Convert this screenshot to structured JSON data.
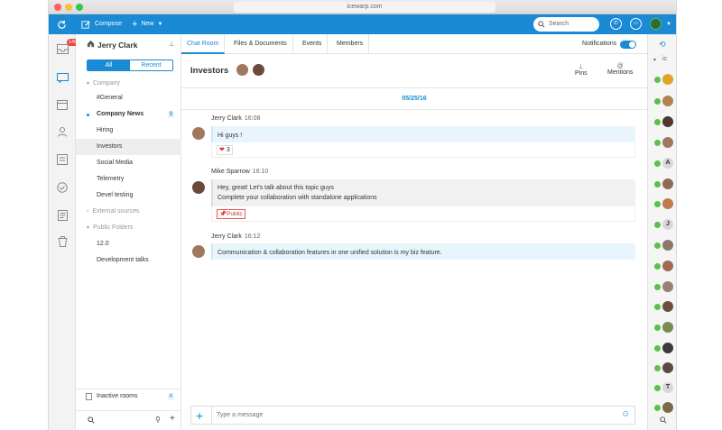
{
  "window": {
    "url": "icewarp.com"
  },
  "toolbar": {
    "compose": "Compose",
    "new": "New",
    "search_placeholder": "Search"
  },
  "rail": {
    "mail_badge": "149"
  },
  "sidebar": {
    "user": "Jerry Clark",
    "filter": {
      "all": "All",
      "recent": "Recent"
    },
    "groups": {
      "company": "Company",
      "external": "External sources",
      "public": "Public Folders"
    },
    "items": [
      {
        "label": "#General"
      },
      {
        "label": "Company News",
        "count": "3"
      },
      {
        "label": "Hiring"
      },
      {
        "label": "Investors"
      },
      {
        "label": "Social Media"
      },
      {
        "label": "Telemetry"
      },
      {
        "label": "Devel testing"
      }
    ],
    "public_items": [
      {
        "label": "12.0"
      },
      {
        "label": "Development talks"
      }
    ],
    "inactive": {
      "label": "Inactive rooms",
      "count": "4"
    }
  },
  "tabs": [
    {
      "label": "Chat Room"
    },
    {
      "label": "Files & Documents"
    },
    {
      "label": "Events"
    },
    {
      "label": "Members"
    }
  ],
  "notifications_label": "Notifications",
  "room": {
    "title": "Investors",
    "pins": "Pins",
    "mentions": "Mentions"
  },
  "date": "05/25/16",
  "messages": [
    {
      "author": "Jerry Clark",
      "time": "16:08",
      "lines": [
        "Hi guys !"
      ],
      "reaction": "3"
    },
    {
      "author": "Mike Sparrow",
      "time": "16:10",
      "lines": [
        "Hey, great! Let's talk about this topic guys",
        "Complete your collaboration with standalone applications"
      ],
      "tag": "Public"
    },
    {
      "author": "Jerry Clark",
      "time": "16:12",
      "lines": [
        "Communication & collaboration features in one unified solution is my biz feature."
      ]
    }
  ],
  "composer": {
    "placeholder": "Type a message"
  },
  "right_panel": {
    "filter": "ic",
    "letters": [
      "A",
      "J",
      "T"
    ]
  },
  "colors": {
    "accent": "#1a8ad4",
    "online": "#5cc04a",
    "badge": "#e44444"
  }
}
